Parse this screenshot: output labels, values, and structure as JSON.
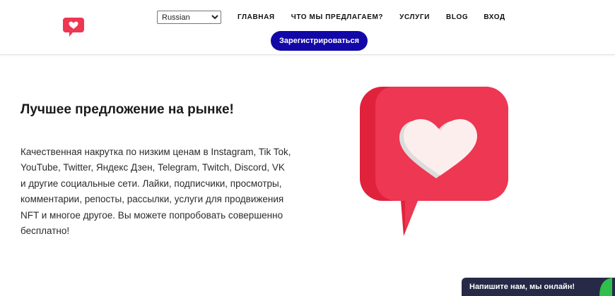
{
  "header": {
    "language": {
      "selected": "Russian"
    },
    "nav": [
      {
        "label": "Главная"
      },
      {
        "label": "Что мы предлагаем?"
      },
      {
        "label": "Услуги"
      },
      {
        "label": "Blog"
      },
      {
        "label": "Вход"
      }
    ],
    "register_label": "Зарегистрироваться"
  },
  "hero": {
    "title": "Лучшее предложение на рынке!",
    "text": "Качественная накрутка по низким ценам в Instagram, Tik Tok, YouTube, Twitter, Яндекс Дзен, Telegram, Twitch, Discord, VK и другие социальные сети. Лайки, подписчики, просмотры, комментарии, репосты, рассылки, услуги для продвижения NFT и многое другое. Вы можете попробовать совершенно бесплатно!",
    "image_icon": "heart-chat-bubble-icon"
  },
  "chat": {
    "label": "Напишите нам, мы онлайн!"
  },
  "colors": {
    "brand_red": "#ee3752",
    "brand_red_dark": "#e1223c",
    "heart_light": "#fdeeee",
    "heart_shadow": "#dcdcdc",
    "register_button": "#1208a8",
    "chat_bg": "#262a47",
    "chat_accent": "#2fbf4a"
  }
}
